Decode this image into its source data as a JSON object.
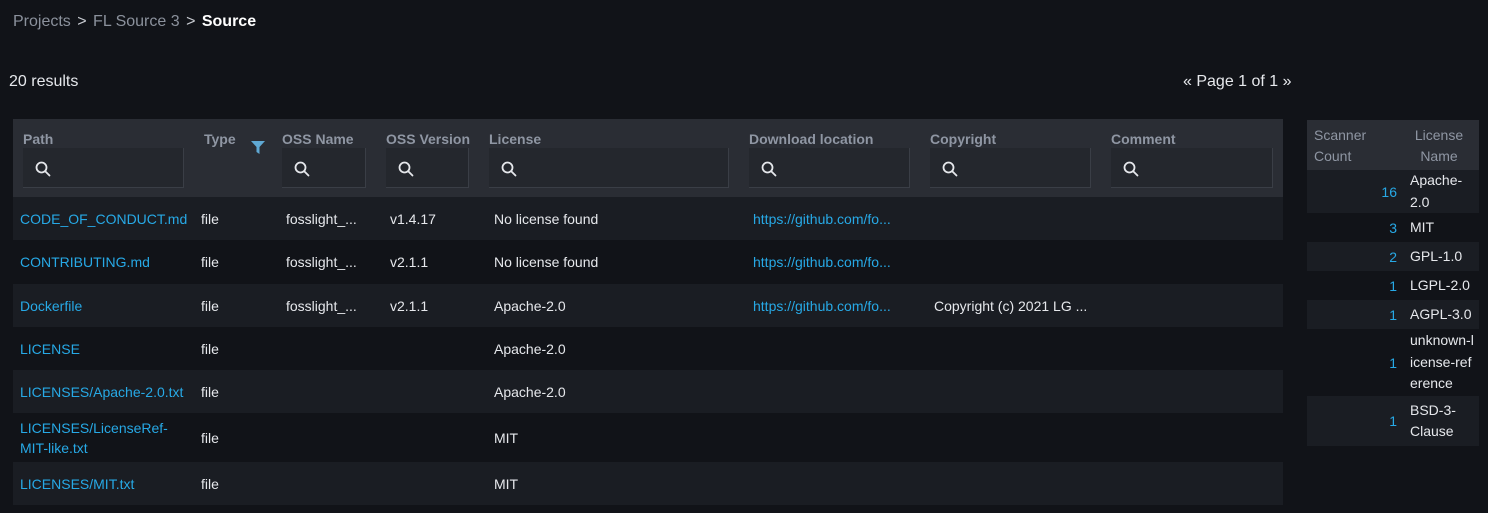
{
  "breadcrumb": {
    "items": [
      "Projects",
      "FL Source 3"
    ],
    "separator": ">",
    "current": "Source"
  },
  "results_count": "20 results",
  "pager": {
    "prev": "«",
    "label": "Page 1 of 1",
    "next": "»"
  },
  "table": {
    "columns": [
      {
        "label": "Path",
        "searchable": true
      },
      {
        "label": "Type",
        "searchable": false,
        "filter": true
      },
      {
        "label": "OSS Name",
        "searchable": true
      },
      {
        "label": "OSS Version",
        "searchable": true
      },
      {
        "label": "License",
        "searchable": true
      },
      {
        "label": "Download location",
        "searchable": true
      },
      {
        "label": "Copyright",
        "searchable": true
      },
      {
        "label": "Comment",
        "searchable": true
      }
    ],
    "rows": [
      {
        "path": "CODE_OF_CONDUCT.md",
        "type": "file",
        "oss_name": "fosslight_...",
        "oss_version": "v1.4.17",
        "license": "No license found",
        "download": "https://github.com/fo...",
        "copyright": "",
        "comment": ""
      },
      {
        "path": "CONTRIBUTING.md",
        "type": "file",
        "oss_name": "fosslight_...",
        "oss_version": "v2.1.1",
        "license": "No license found",
        "download": "https://github.com/fo...",
        "copyright": "",
        "comment": ""
      },
      {
        "path": "Dockerfile",
        "type": "file",
        "oss_name": "fosslight_...",
        "oss_version": "v2.1.1",
        "license": "Apache-2.0",
        "download": "https://github.com/fo...",
        "copyright": "Copyright (c) 2021 LG ...",
        "comment": ""
      },
      {
        "path": "LICENSE",
        "type": "file",
        "oss_name": "",
        "oss_version": "",
        "license": "Apache-2.0",
        "download": "",
        "copyright": "",
        "comment": ""
      },
      {
        "path": "LICENSES/Apache-2.0.txt",
        "type": "file",
        "oss_name": "",
        "oss_version": "",
        "license": "Apache-2.0",
        "download": "",
        "copyright": "",
        "comment": ""
      },
      {
        "path": "LICENSES/LicenseRef-MIT-like.txt",
        "type": "file",
        "oss_name": "",
        "oss_version": "",
        "license": "MIT",
        "download": "",
        "copyright": "",
        "comment": ""
      },
      {
        "path": "LICENSES/MIT.txt",
        "type": "file",
        "oss_name": "",
        "oss_version": "",
        "license": "MIT",
        "download": "",
        "copyright": "",
        "comment": ""
      }
    ]
  },
  "license_summary": {
    "header_count": "Scanner Count",
    "header_name": "License Name",
    "rows": [
      {
        "count": "16",
        "name": "Apache-2.0"
      },
      {
        "count": "3",
        "name": "MIT"
      },
      {
        "count": "2",
        "name": "GPL-1.0"
      },
      {
        "count": "1",
        "name": "LGPL-2.0"
      },
      {
        "count": "1",
        "name": "AGPL-3.0"
      },
      {
        "count": "1",
        "name": "unknown-license-reference"
      },
      {
        "count": "1",
        "name": "BSD-3-Clause"
      }
    ]
  },
  "colors": {
    "background": "#111318",
    "header_bg": "#2a2d34",
    "row_alt_bg": "#1a1d23",
    "link": "#27a9e6",
    "filter_icon": "#5fa8d3"
  },
  "icons": {
    "search": "search-icon",
    "filter": "filter-icon"
  }
}
